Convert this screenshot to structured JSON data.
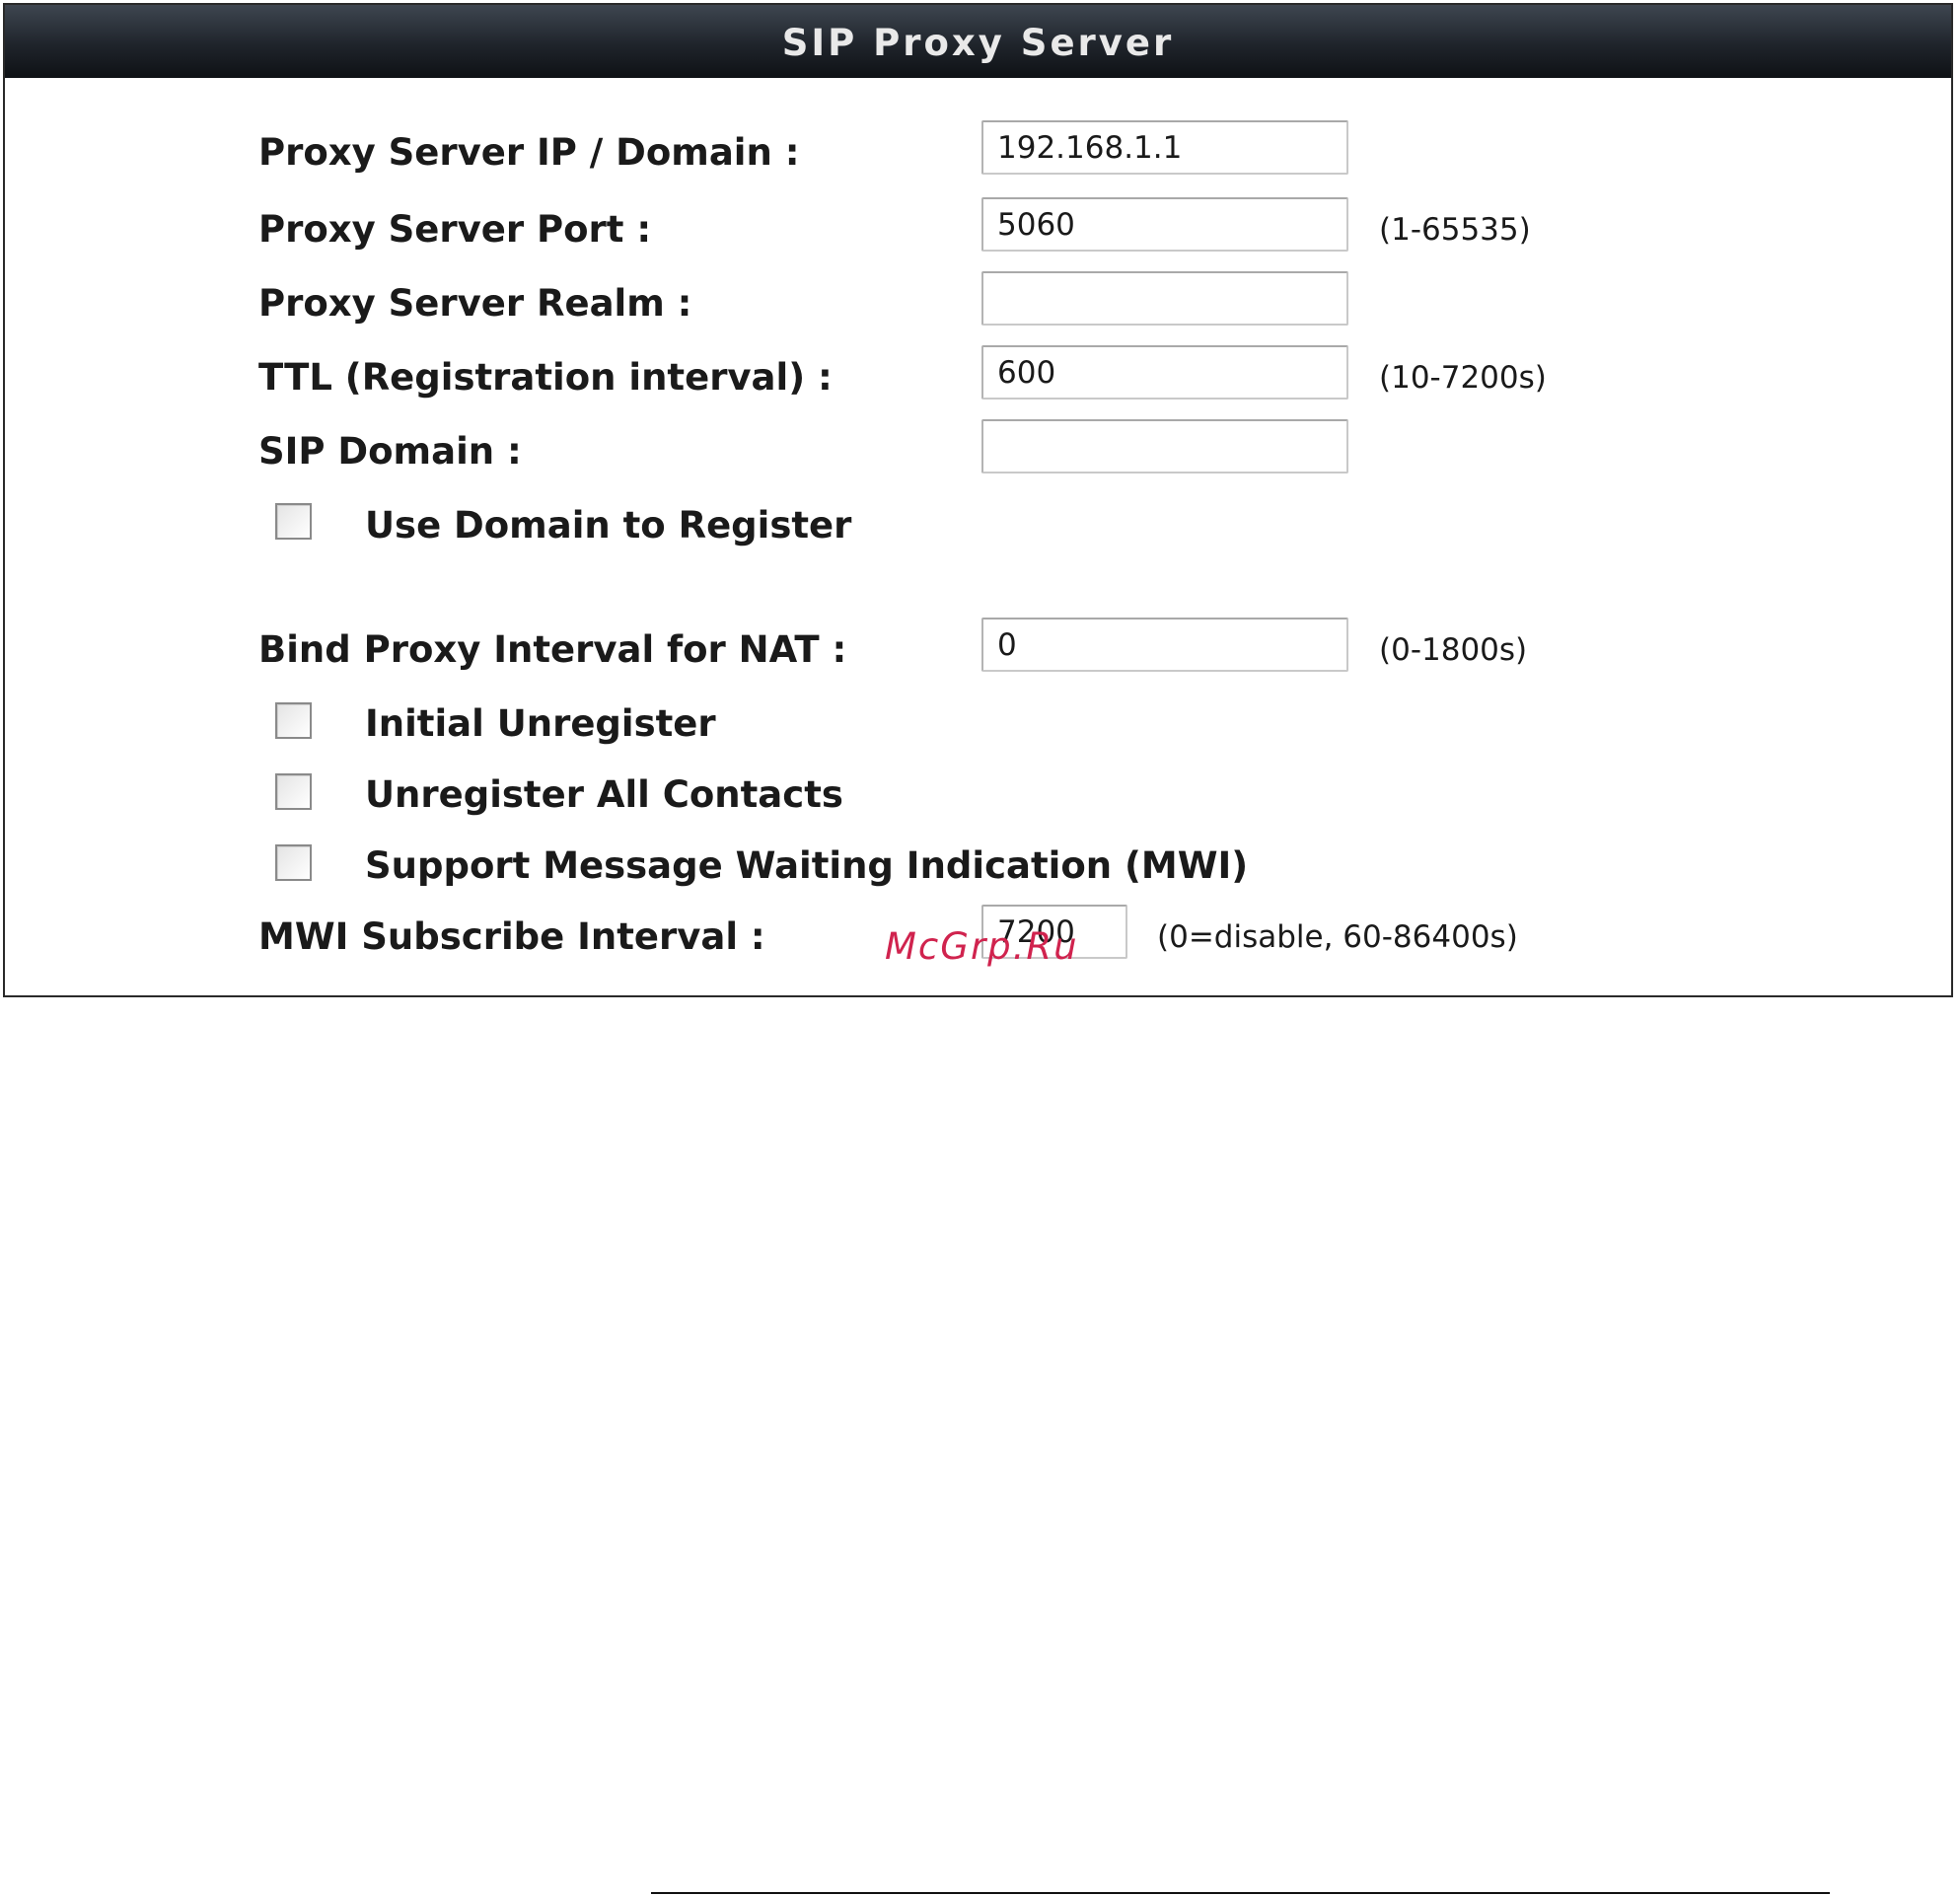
{
  "panel": {
    "title": "SIP Proxy Server"
  },
  "fields": {
    "proxy_ip": {
      "label": "Proxy Server IP / Domain :",
      "value": "192.168.1.1"
    },
    "proxy_port": {
      "label": "Proxy Server Port :",
      "value": "5060",
      "hint": "(1-65535)"
    },
    "proxy_realm": {
      "label": "Proxy Server Realm :",
      "value": ""
    },
    "ttl": {
      "label": "TTL (Registration interval) :",
      "value": "600",
      "hint": "(10-7200s)"
    },
    "sip_domain": {
      "label": "SIP Domain :",
      "value": ""
    },
    "bind_interval": {
      "label": "Bind Proxy Interval for NAT :",
      "value": "0",
      "hint": "(0-1800s)"
    },
    "mwi_interval": {
      "label": "MWI Subscribe Interval :",
      "value": "7200",
      "hint": "(0=disable, 60-86400s)"
    }
  },
  "checkboxes": {
    "use_domain": {
      "label": "Use Domain to Register",
      "checked": false
    },
    "initial_unregister": {
      "label": "Initial Unregister",
      "checked": false
    },
    "unregister_all": {
      "label": "Unregister All Contacts",
      "checked": false
    },
    "support_mwi": {
      "label": "Support Message Waiting Indication (MWI)",
      "checked": false
    }
  },
  "watermark": "McGrp.Ru",
  "colors": {
    "header_bg": "#1f242b",
    "header_text": "#e9e9e9",
    "watermark": "#d0234e"
  }
}
